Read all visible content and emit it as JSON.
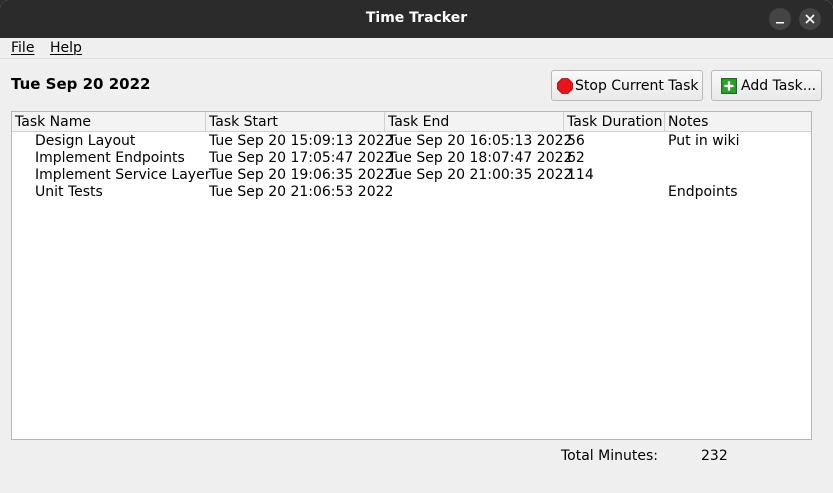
{
  "window": {
    "title": "Time Tracker"
  },
  "menu": {
    "file": "File",
    "help": "Help"
  },
  "header": {
    "date": "Tue Sep 20 2022"
  },
  "toolbar": {
    "stop_label": "Stop Current Task",
    "add_label": "Add Task..."
  },
  "table": {
    "columns": [
      "Task Name",
      "Task Start",
      "Task End",
      "Task Duration",
      "Notes"
    ],
    "rows": [
      [
        "Design Layout",
        "Tue Sep 20 15:09:13 2022",
        "Tue Sep 20 16:05:13 2022",
        "56",
        "Put in wiki"
      ],
      [
        "Implement Endpoints",
        "Tue Sep 20 17:05:47 2022",
        "Tue Sep 20 18:07:47 2022",
        "62",
        ""
      ],
      [
        "Implement Service Layer",
        "Tue Sep 20 19:06:35 2022",
        "Tue Sep 20 21:00:35 2022",
        "114",
        ""
      ],
      [
        "Unit Tests",
        "Tue Sep 20 21:06:53 2022",
        "",
        "",
        "Endpoints"
      ]
    ]
  },
  "footer": {
    "total_label": "Total Minutes:",
    "total_value": "232"
  },
  "icons": {
    "stop": "stop-sign-icon",
    "add": "plus-box-icon",
    "minimize": "minimize-icon",
    "close": "close-icon"
  },
  "colors": {
    "stop_red": "#e8141a",
    "add_green": "#2e9e2e",
    "titlebar": "#2b2b2b"
  }
}
